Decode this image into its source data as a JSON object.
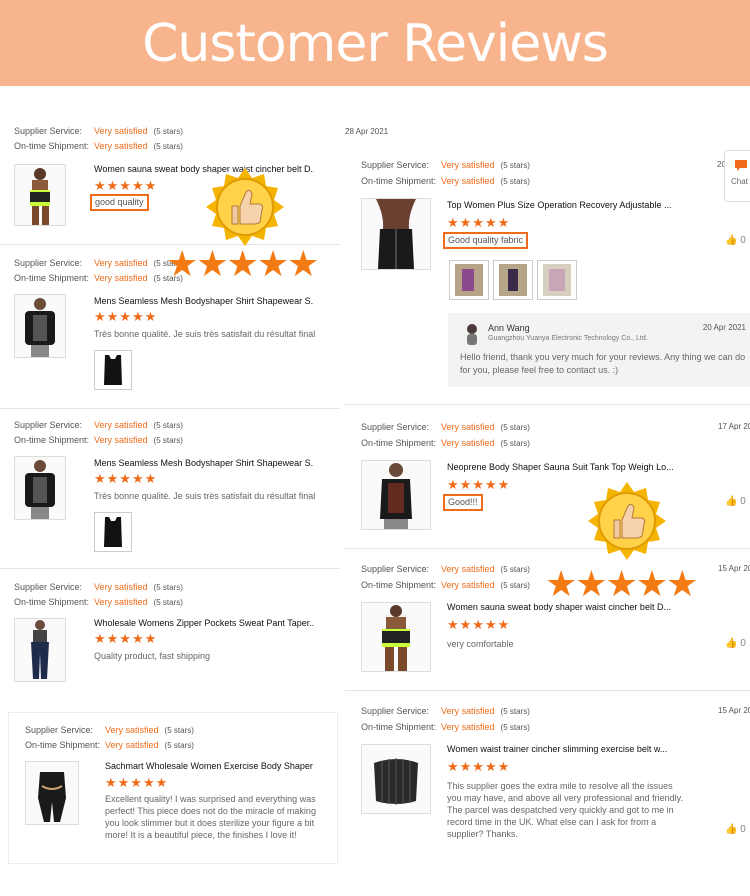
{
  "banner": {
    "title": "Customer Reviews"
  },
  "labels": {
    "supplier_service": "Supplier Service:",
    "ontime_shipment": "On-time Shipment:",
    "very_satisfied": "Very satisfied",
    "five_stars": "(5 stars)",
    "stars": "★★★★★",
    "big_stars": "★★★★★"
  },
  "left_reviews": [
    {
      "title": "Women sauna sweat body shaper waist cincher belt D...",
      "comment": "good quality",
      "highlighted": true
    },
    {
      "title": "Mens Seamless Mesh Bodyshaper Shirt Shapewear S...",
      "comment": "Très bonne qualité. Je suis très satisfait du résultat final",
      "highlighted": false
    },
    {
      "title": "Mens Seamless Mesh Bodyshaper Shirt Shapewear S...",
      "comment": "Très bonne qualité. Je suis très satisfait du résultat final",
      "highlighted": false
    },
    {
      "title": "Wholesale Womens Zipper Pockets Sweat Pant Taper...",
      "comment": "Quality product, fast shipping",
      "highlighted": false
    },
    {
      "title": "Sachmart Wholesale Women Exercise Body Shaper T...",
      "comment": "Excellent quality!  I was surprised and everything was perfect!  This piece does not do the miracle of making you look slimmer but it does sterilize your figure a bit more!  It is a beautiful piece, the finishes I love it!",
      "highlighted": false
    }
  ],
  "right_reviews": [
    {
      "date": "28 Apr 2021",
      "date2": "20",
      "title": "Top Women Plus Size Operation Recovery Adjustable ...",
      "comment": "Good quality fabric",
      "likes": "0"
    },
    {
      "date": "17 Apr 20",
      "title": "Neoprene Body Shaper Sauna Suit Tank Top Weigh Lo...",
      "comment": "Good!!!",
      "likes": "0"
    },
    {
      "date": "15 Apr 20",
      "title": "Women sauna sweat body shaper waist cincher belt D...",
      "comment": "very comfortable",
      "likes": "0"
    },
    {
      "date": "15 Apr 20",
      "title": "Women waist trainer cincher slimming exercise belt w...",
      "comment": "This supplier goes the extra mile to resolve all the issues you may have, and above all very professional and friendly. The parcel was despatched very quickly and got to me in record time in the UK.  What else can I ask for from a supplier?  Thanks.",
      "likes": "0"
    }
  ],
  "reply": {
    "name": "Ann Wang",
    "company": "Guangzhou Yuanya Electronic Technology Co., Ltd.",
    "date": "20 Apr 2021",
    "message": "Hello friend, thank you very much for your reviews. Any thing we can do for you, please feel free to contact us. :)"
  },
  "chat": {
    "label": "Chat"
  },
  "colors": {
    "accent": "#ef6b1a",
    "banner": "#f8b48c",
    "thumb_gold": "#f5b400"
  },
  "icons": {
    "like": "thumbs-up-icon",
    "chat": "chat-icon",
    "badge": "thumbs-up-badge"
  }
}
